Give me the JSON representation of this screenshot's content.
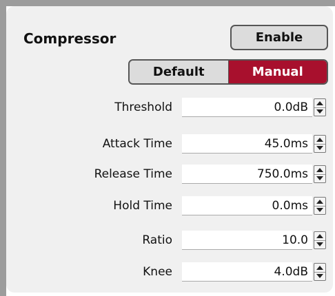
{
  "panel": {
    "title": "Compressor",
    "enable_label": "Enable"
  },
  "mode": {
    "options": [
      "Default",
      "Manual"
    ],
    "selected": "Manual",
    "accent_color": "#a8102d"
  },
  "params": [
    {
      "label": "Threshold",
      "value": "0.0dB"
    },
    {
      "label": "Attack Time",
      "value": "45.0ms"
    },
    {
      "label": "Release Time",
      "value": "750.0ms"
    },
    {
      "label": "Hold Time",
      "value": "0.0ms"
    },
    {
      "label": "Ratio",
      "value": "10.0"
    },
    {
      "label": "Knee",
      "value": "4.0dB"
    }
  ]
}
